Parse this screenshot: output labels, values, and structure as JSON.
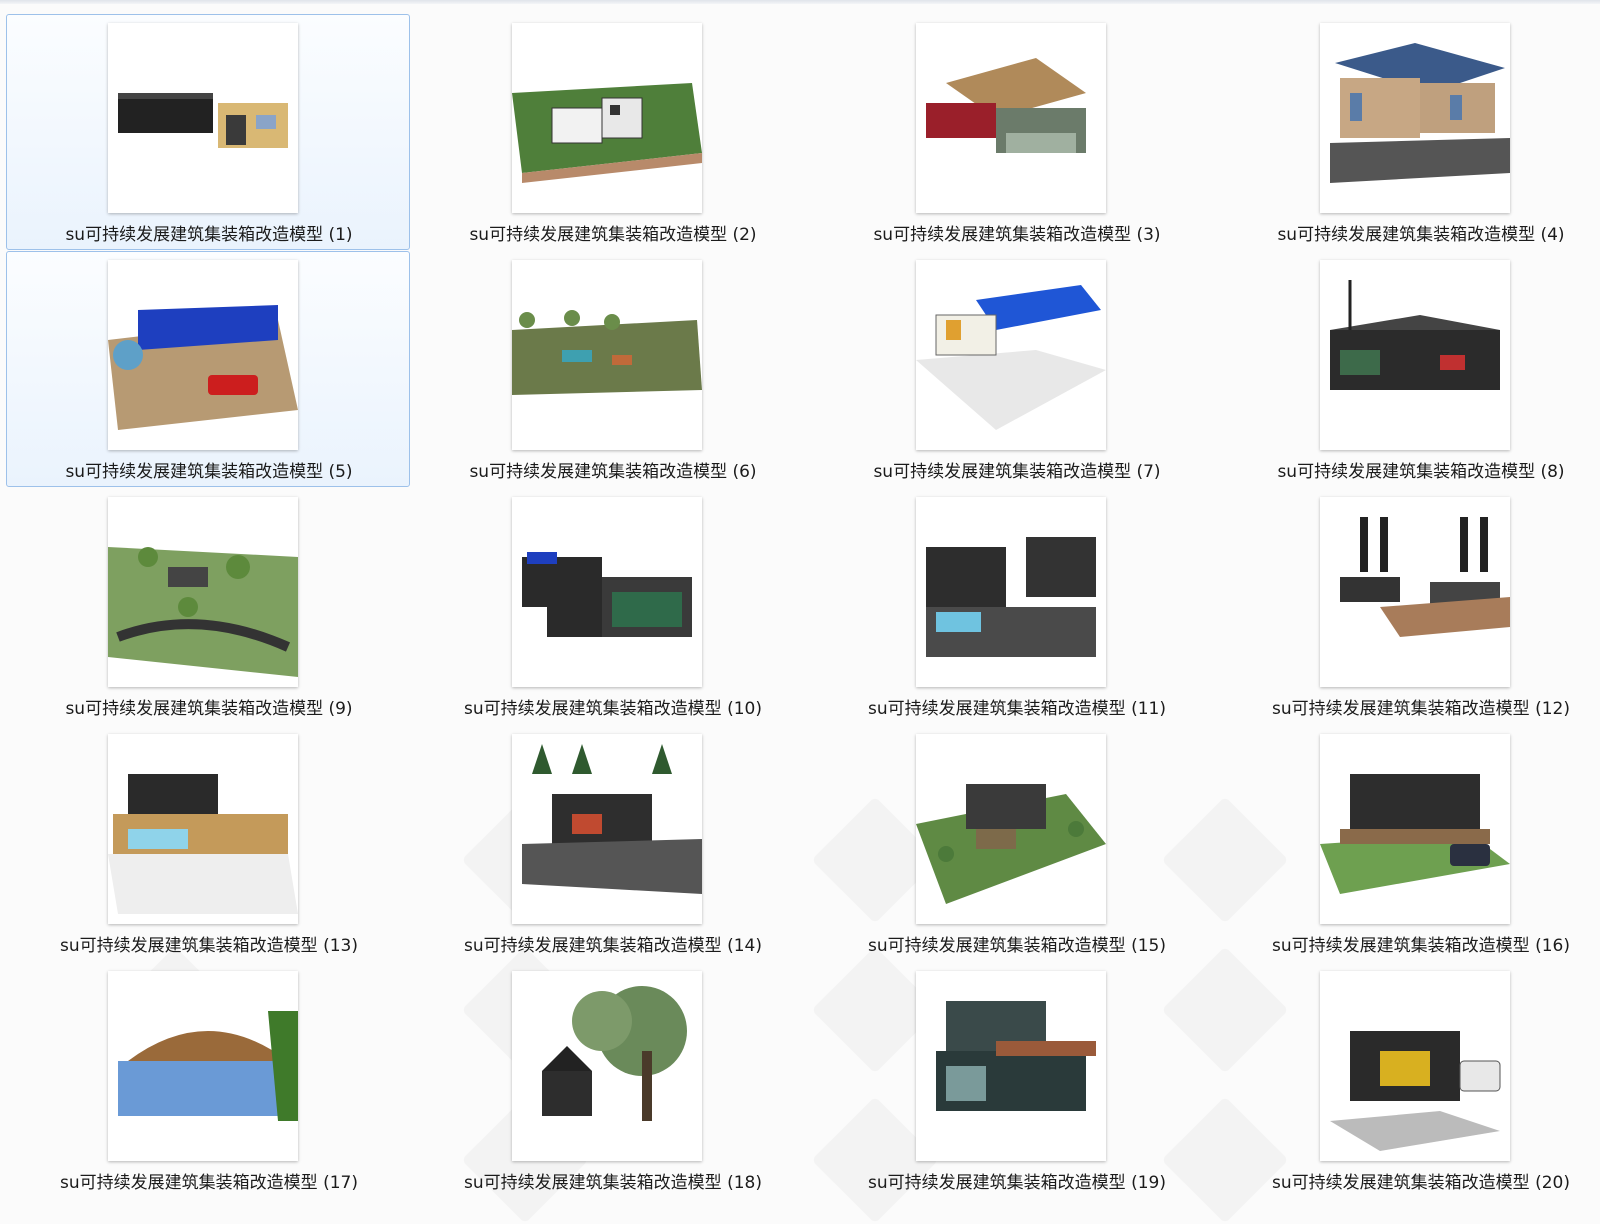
{
  "files": [
    {
      "name": "su可持续发展建筑集装箱改造模型 (1)",
      "thumbnail": "container-house-model-thumbnail",
      "selected": true
    },
    {
      "name": "su可持续发展建筑集装箱改造模型 (2)",
      "thumbnail": "container-house-model-thumbnail",
      "selected": false
    },
    {
      "name": "su可持续发展建筑集装箱改造模型 (3)",
      "thumbnail": "container-house-model-thumbnail",
      "selected": false
    },
    {
      "name": "su可持续发展建筑集装箱改造模型 (4)",
      "thumbnail": "container-house-model-thumbnail",
      "selected": false
    },
    {
      "name": "su可持续发展建筑集装箱改造模型 (5)",
      "thumbnail": "container-house-model-thumbnail",
      "selected": true
    },
    {
      "name": "su可持续发展建筑集装箱改造模型 (6)",
      "thumbnail": "container-house-model-thumbnail",
      "selected": false
    },
    {
      "name": "su可持续发展建筑集装箱改造模型 (7)",
      "thumbnail": "container-house-model-thumbnail",
      "selected": false
    },
    {
      "name": "su可持续发展建筑集装箱改造模型 (8)",
      "thumbnail": "container-house-model-thumbnail",
      "selected": false
    },
    {
      "name": "su可持续发展建筑集装箱改造模型 (9)",
      "thumbnail": "container-house-model-thumbnail",
      "selected": false
    },
    {
      "name": "su可持续发展建筑集装箱改造模型 (10)",
      "thumbnail": "container-house-model-thumbnail",
      "selected": false
    },
    {
      "name": "su可持续发展建筑集装箱改造模型 (11)",
      "thumbnail": "container-house-model-thumbnail",
      "selected": false
    },
    {
      "name": "su可持续发展建筑集装箱改造模型 (12)",
      "thumbnail": "container-house-model-thumbnail",
      "selected": false
    },
    {
      "name": "su可持续发展建筑集装箱改造模型 (13)",
      "thumbnail": "container-house-model-thumbnail",
      "selected": false
    },
    {
      "name": "su可持续发展建筑集装箱改造模型 (14)",
      "thumbnail": "container-house-model-thumbnail",
      "selected": false
    },
    {
      "name": "su可持续发展建筑集装箱改造模型 (15)",
      "thumbnail": "container-house-model-thumbnail",
      "selected": false
    },
    {
      "name": "su可持续发展建筑集装箱改造模型 (16)",
      "thumbnail": "container-house-model-thumbnail",
      "selected": false
    },
    {
      "name": "su可持续发展建筑集装箱改造模型 (17)",
      "thumbnail": "container-house-model-thumbnail",
      "selected": false
    },
    {
      "name": "su可持续发展建筑集装箱改造模型 (18)",
      "thumbnail": "container-house-model-thumbnail",
      "selected": false
    },
    {
      "name": "su可持续发展建筑集装箱改造模型 (19)",
      "thumbnail": "container-house-model-thumbnail",
      "selected": false
    },
    {
      "name": "su可持续发展建筑集装箱改造模型 (20)",
      "thumbnail": "container-house-model-thumbnail",
      "selected": false
    }
  ],
  "colors": {
    "selection_fill": "#eaf3fd",
    "selection_border": "#9dc1ea",
    "label_text": "#1b1b1b"
  }
}
